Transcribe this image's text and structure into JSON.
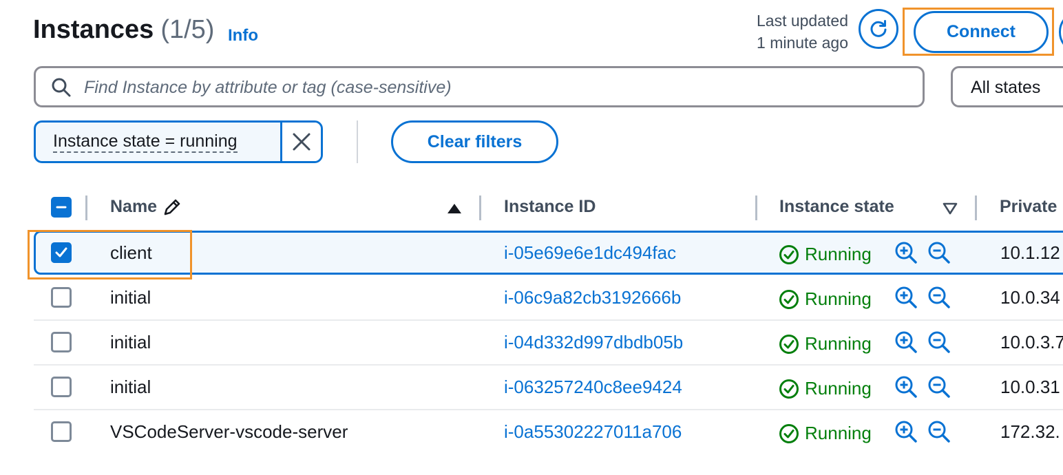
{
  "header": {
    "title": "Instances",
    "count": "(1/5)",
    "info_label": "Info",
    "last_updated_line1": "Last updated",
    "last_updated_line2": "1 minute ago",
    "connect_label": "Connect"
  },
  "search": {
    "placeholder": "Find Instance by attribute or tag (case-sensitive)",
    "value": ""
  },
  "state_filter": {
    "selected": "All states"
  },
  "filter_token": {
    "label": "Instance state = running"
  },
  "clear_filters_label": "Clear filters",
  "table": {
    "columns": [
      "Name",
      "Instance ID",
      "Instance state",
      "Private"
    ],
    "rows": [
      {
        "name": "client",
        "instance_id": "i-05e69e6e1dc494fac",
        "state": "Running",
        "private_ip": "10.1.12",
        "selected": true
      },
      {
        "name": "initial",
        "instance_id": "i-06c9a82cb3192666b",
        "state": "Running",
        "private_ip": "10.0.34",
        "selected": false
      },
      {
        "name": "initial",
        "instance_id": "i-04d332d997dbdb05b",
        "state": "Running",
        "private_ip": "10.0.3.7",
        "selected": false
      },
      {
        "name": "initial",
        "instance_id": "i-063257240c8ee9424",
        "state": "Running",
        "private_ip": "10.0.31",
        "selected": false
      },
      {
        "name": "VSCodeServer-vscode-server",
        "instance_id": "i-0a55302227011a706",
        "state": "Running",
        "private_ip": "172.32.",
        "selected": false
      }
    ]
  },
  "icons": {
    "search": "search-icon",
    "refresh": "refresh-icon",
    "close": "close-icon",
    "edit": "pencil-icon",
    "sort_asc": "sort-ascending-icon",
    "filter_desc": "filter-triangle-icon",
    "status_ok": "check-circle-icon",
    "zoom_in": "zoom-in-icon",
    "zoom_out": "zoom-out-icon"
  },
  "colors": {
    "accent": "#0972d3",
    "success": "#037f0c",
    "highlight": "#f0932b"
  }
}
